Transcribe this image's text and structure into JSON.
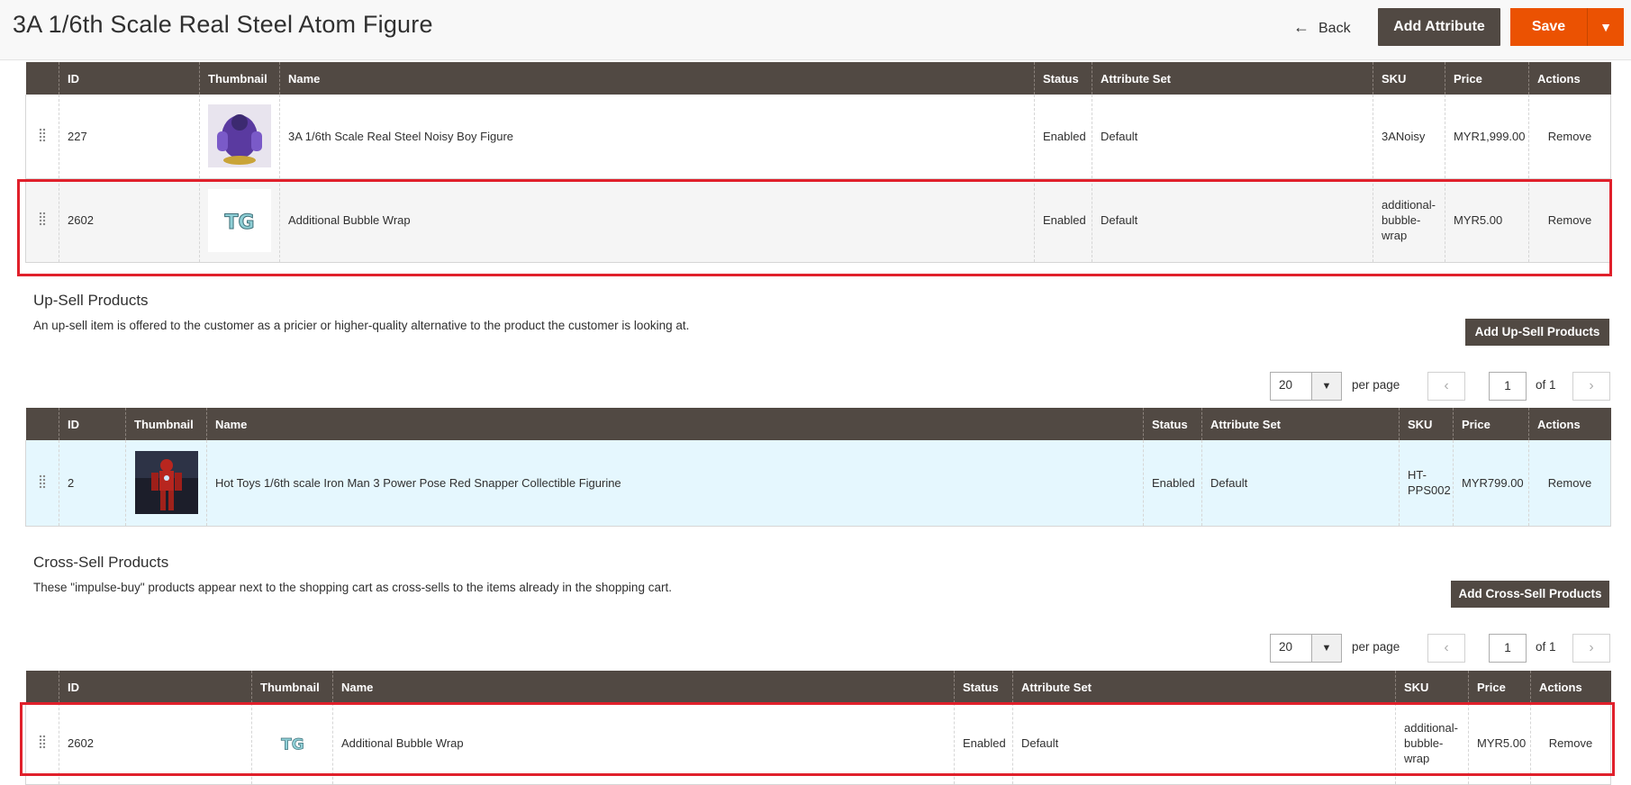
{
  "header": {
    "title": "3A 1/6th Scale Real Steel Atom Figure",
    "back_label": "Back",
    "add_attribute_label": "Add Attribute",
    "save_label": "Save"
  },
  "related": {
    "columns": [
      "ID",
      "Thumbnail",
      "Name",
      "Status",
      "Attribute Set",
      "SKU",
      "Price",
      "Actions"
    ],
    "rows": [
      {
        "id": "227",
        "name": "3A 1/6th Scale Real Steel Noisy Boy Figure",
        "status": "Enabled",
        "attribute_set": "Default",
        "sku": "3ANoisy",
        "price": "MYR1,999.00",
        "action": "Remove"
      },
      {
        "id": "2602",
        "name": "Additional Bubble Wrap",
        "status": "Enabled",
        "attribute_set": "Default",
        "sku": "additional-bubble-wrap",
        "price": "MYR5.00",
        "action": "Remove"
      }
    ]
  },
  "upsell": {
    "title": "Up-Sell Products",
    "description": "An up-sell item is offered to the customer as a pricier or higher-quality alternative to the product the customer is looking at.",
    "add_button": "Add Up-Sell Products",
    "per_page_value": "20",
    "per_page_label": "per page",
    "page_current": "1",
    "page_of": "of 1",
    "columns": [
      "ID",
      "Thumbnail",
      "Name",
      "Status",
      "Attribute Set",
      "SKU",
      "Price",
      "Actions"
    ],
    "rows": [
      {
        "id": "2",
        "name": "Hot Toys 1/6th scale Iron Man 3 Power Pose Red Snapper Collectible Figurine",
        "status": "Enabled",
        "attribute_set": "Default",
        "sku": "HT-PPS002",
        "price": "MYR799.00",
        "action": "Remove"
      }
    ]
  },
  "crosssell": {
    "title": "Cross-Sell Products",
    "description": "These \"impulse-buy\" products appear next to the shopping cart as cross-sells to the items already in the shopping cart.",
    "add_button": "Add Cross-Sell Products",
    "per_page_value": "20",
    "per_page_label": "per page",
    "page_current": "1",
    "page_of": "of 1",
    "columns": [
      "ID",
      "Thumbnail",
      "Name",
      "Status",
      "Attribute Set",
      "SKU",
      "Price",
      "Actions"
    ],
    "rows": [
      {
        "id": "2602",
        "name": "Additional Bubble Wrap",
        "status": "Enabled",
        "attribute_set": "Default",
        "sku": "additional-bubble-wrap",
        "price": "MYR5.00",
        "action": "Remove"
      }
    ]
  },
  "icons": {
    "back": "arrow-left-icon",
    "drag": "drag-handle-icon",
    "dropdown": "chevron-down-icon",
    "prev": "chevron-left-icon",
    "next": "chevron-right-icon"
  },
  "colors": {
    "header_bar": "#514943",
    "save": "#eb5202",
    "link": "#007bdb",
    "highlight": "#e0202b",
    "row_selected": "#e5f7fe"
  }
}
